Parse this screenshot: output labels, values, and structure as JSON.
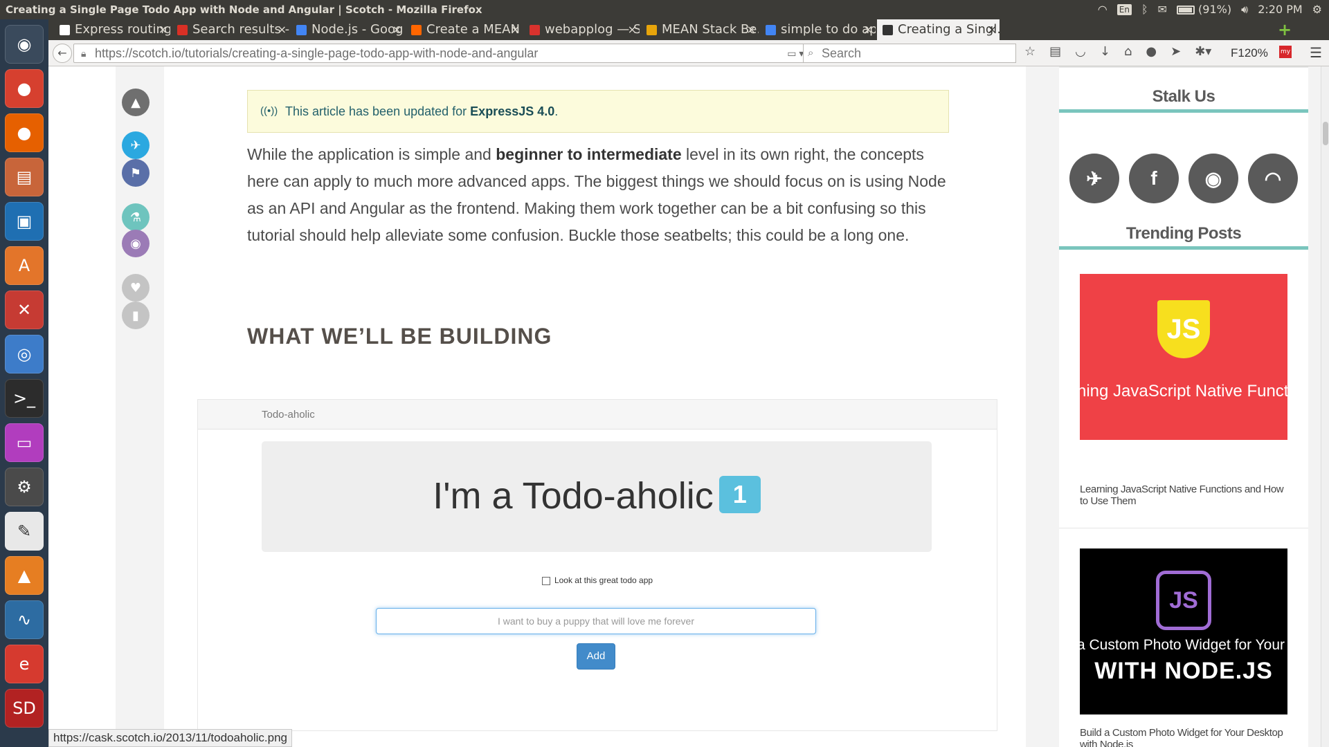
{
  "window": {
    "title": "Creating a Single Page Todo App with Node and Angular | Scotch - Mozilla Firefox"
  },
  "tray": {
    "keyboard": "En",
    "battery": "(91%)",
    "clock": "2:20 PM"
  },
  "launcher": {
    "items": [
      {
        "name": "ubuntu-dash-icon",
        "glyph": "◉",
        "color": "#3a4a5c"
      },
      {
        "name": "chrome-icon",
        "glyph": "●",
        "color": "#d6402f"
      },
      {
        "name": "firefox-icon",
        "glyph": "●",
        "color": "#e66000"
      },
      {
        "name": "files-icon",
        "glyph": "▤",
        "color": "#c8653a"
      },
      {
        "name": "workspace-icon",
        "glyph": "▣",
        "color": "#1f6fb2"
      },
      {
        "name": "software-center-icon",
        "glyph": "A",
        "color": "#e3752a"
      },
      {
        "name": "system-settings-icon",
        "glyph": "✕",
        "color": "#c63b33"
      },
      {
        "name": "chromium-icon",
        "glyph": "◎",
        "color": "#3d7cc9"
      },
      {
        "name": "terminal-icon",
        "glyph": ">_",
        "color": "#2c2c2c"
      },
      {
        "name": "window-app-icon",
        "glyph": "▭",
        "color": "#b13dbe"
      },
      {
        "name": "java-ee-ide-icon",
        "glyph": "⚙",
        "color": "#4a4a4a"
      },
      {
        "name": "text-editor-icon",
        "glyph": "✎",
        "color": "#e8e8e8"
      },
      {
        "name": "vlc-icon",
        "glyph": "▲",
        "color": "#e67e22"
      },
      {
        "name": "system-monitor-icon",
        "glyph": "∿",
        "color": "#2d6ca2"
      },
      {
        "name": "app-e-icon",
        "glyph": "e",
        "color": "#d63a2f"
      },
      {
        "name": "sd-card-icon",
        "glyph": "SD",
        "color": "#b22222"
      }
    ]
  },
  "tabs": [
    {
      "label": "Express routing",
      "favicon_color": "#ffffff"
    },
    {
      "label": "Search results - i…",
      "favicon_color": "#d93025"
    },
    {
      "label": "Node.js - Googl…",
      "favicon_color": "#4285f4"
    },
    {
      "label": "Create a MEAN …",
      "favicon_color": "#ff6600"
    },
    {
      "label": "webapplog — S…",
      "favicon_color": "#d9322d"
    },
    {
      "label": "MEAN Stack Be…",
      "favicon_color": "#e8a50b"
    },
    {
      "label": "simple to do ap…",
      "favicon_color": "#4285f4"
    },
    {
      "label": "Creating a Singl…",
      "favicon_color": "#333333",
      "active": true
    }
  ],
  "nav": {
    "url_prefix": "https://",
    "url_host": "scotch.io",
    "url_path": "/tutorials/creating-a-single-page-todo-app-with-node-and-angular",
    "search_placeholder": "Search",
    "zoom": "F120%"
  },
  "share": [
    {
      "name": "rocket-icon",
      "glyph": "▲",
      "color": "#6f6f6f"
    },
    {
      "name": "twitter-share-icon",
      "glyph": "✈",
      "color": "#2ba8e0"
    },
    {
      "name": "bookmark-share-icon",
      "glyph": "⚑",
      "color": "#5a6fa8"
    },
    {
      "name": "lab-flask-icon",
      "glyph": "⚗",
      "color": "#6ec4be"
    },
    {
      "name": "github-share-icon",
      "glyph": "◉",
      "color": "#9b7bb6"
    },
    {
      "name": "heart-icon",
      "glyph": "♥",
      "color": "#c4c4c4"
    },
    {
      "name": "save-bookmark-icon",
      "glyph": "▮",
      "color": "#c4c4c4"
    }
  ],
  "article": {
    "update_note_text": "This article has been updated for ",
    "update_note_bold": "ExpressJS 4.0",
    "update_note_end": ".",
    "intro_1": "While the application is simple and ",
    "intro_bold": "beginner to intermediate",
    "intro_2": " level in its own right, the concepts here can apply to much more advanced apps. The biggest things we should focus on is using Node as an API and Angular as the frontend. Making them work together can be a bit confusing so this tutorial should help alleviate some confusion. Buckle those seatbelts; this could be a long one.",
    "section_heading": "WHAT WE’LL BE BUILDING"
  },
  "demo": {
    "nav_brand": "Todo-aholic",
    "jumbo_title": "I'm a Todo-aholic",
    "badge_count": "1",
    "todo_item": "Look at this great todo app",
    "input_placeholder": "I want to buy a puppy that will love me forever",
    "add_label": "Add"
  },
  "sidebar": {
    "stalk_title": "Stalk Us",
    "social": [
      {
        "name": "twitter-icon",
        "glyph": "✈"
      },
      {
        "name": "facebook-icon",
        "glyph": "f"
      },
      {
        "name": "github-icon",
        "glyph": "◉"
      },
      {
        "name": "rss-icon",
        "glyph": "◠"
      }
    ],
    "trending_title": "Trending Posts",
    "posts": [
      {
        "image_logo": "JS",
        "image_text": "ning JavaScript Native Funct",
        "image_bg": "#ef4146",
        "logo_color": "#f7df1e",
        "caption": "Learning JavaScript Native Functions and How to Use Them"
      },
      {
        "image_logo": "JS",
        "image_text": "a Custom Photo Widget for Your De",
        "image_text_2": "WITH NODE.JS",
        "image_bg": "#000000",
        "logo_color": "#a06cd5",
        "caption": "Build a Custom Photo Widget for Your Desktop with Node.js"
      }
    ]
  },
  "status": {
    "link": "https://cask.scotch.io/2013/11/todoaholic.png"
  },
  "colors": {
    "accent_rule": "#7ac5bd",
    "badge": "#5bc0de",
    "primary_button": "#428bca"
  }
}
